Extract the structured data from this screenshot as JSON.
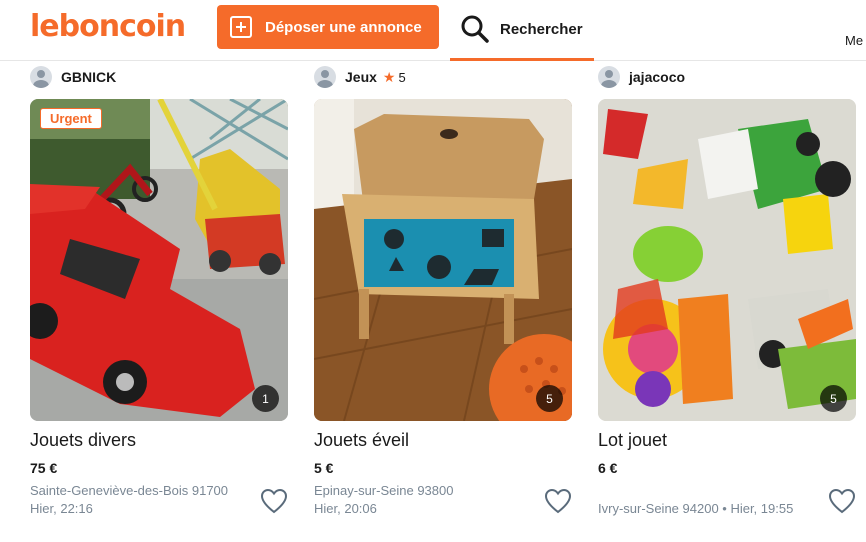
{
  "header": {
    "logo": "leboncoin",
    "post_button": "Déposer une annonce",
    "search_label": "Rechercher",
    "menu_truncated": "Me"
  },
  "colors": {
    "brand": "#f56b2a",
    "text": "#1a1a1a",
    "muted": "#7a8794"
  },
  "icons": [
    "plus-square-icon",
    "search-icon",
    "avatar-icon",
    "star-icon",
    "heart-icon"
  ],
  "listings": [
    {
      "seller": "GBNICK",
      "badge": "Urgent",
      "photo_count": "1",
      "title": "Jouets divers",
      "price": "75 €",
      "location": "Sainte-Geneviève-des-Bois 91700",
      "date": "Hier, 22:16"
    },
    {
      "seller": "Jeux",
      "rating": "5",
      "photo_count": "5",
      "title": "Jouets éveil",
      "price": "5 €",
      "location": "Epinay-sur-Seine 93800",
      "date": "Hier, 20:06"
    },
    {
      "seller": "jajacoco",
      "photo_count": "5",
      "title": "Lot jouet",
      "price": "6 €",
      "location_date": "Ivry-sur-Seine 94200 • Hier, 19:55"
    }
  ]
}
